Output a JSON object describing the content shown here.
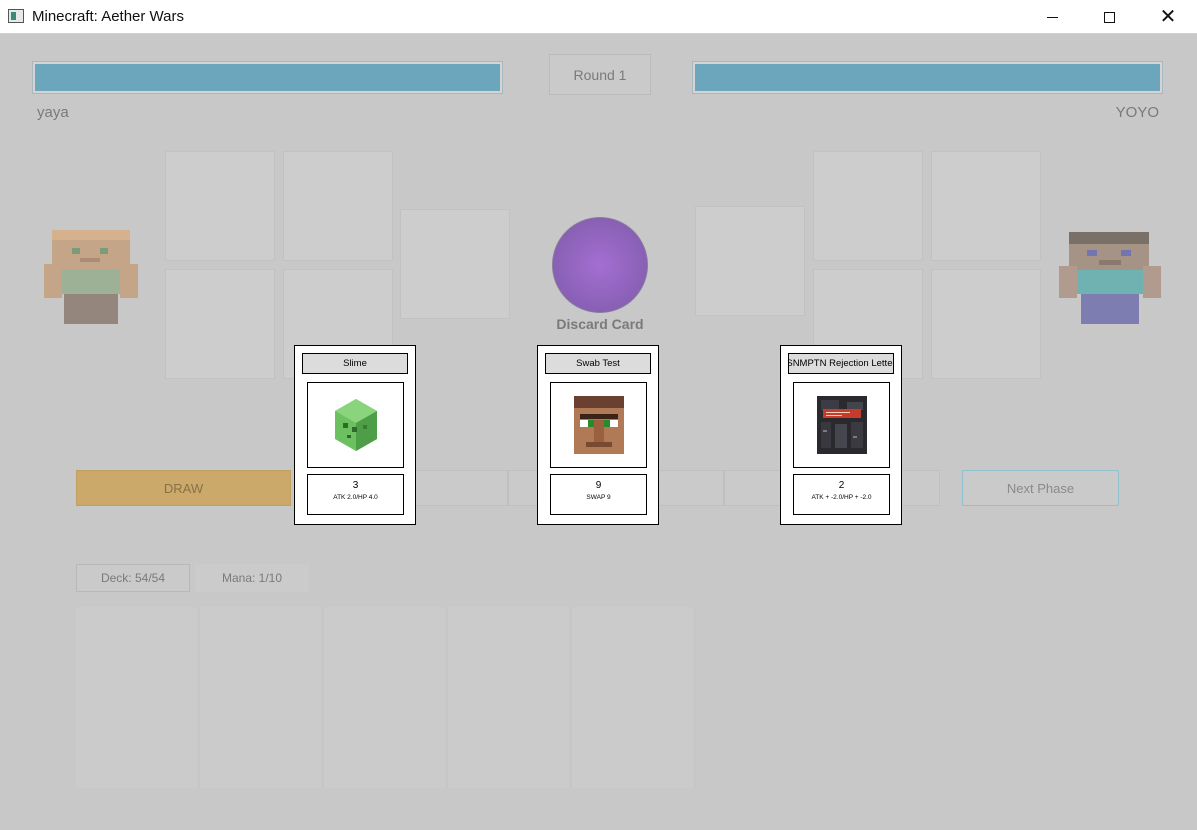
{
  "window": {
    "title": "Minecraft: Aether Wars"
  },
  "round": {
    "label": "Round 1"
  },
  "players": {
    "left": {
      "name": "yaya",
      "hp_fraction": 1.0
    },
    "right": {
      "name": "YOYO",
      "hp_fraction": 1.0
    }
  },
  "discard": {
    "label": "Discard Card"
  },
  "actions": {
    "draw_label": "DRAW",
    "next_phase_label": "Next Phase"
  },
  "status": {
    "deck": "Deck: 54/54",
    "mana": "Mana: 1/10"
  },
  "cards": [
    {
      "title": "Slime",
      "cost": "3",
      "effect": "ATK 2.0/HP 4.0",
      "art_icon": "slime-icon"
    },
    {
      "title": "Swab Test",
      "cost": "9",
      "effect": "SWAP 9",
      "art_icon": "villager-face-icon"
    },
    {
      "title": "SNMPTN Rejection Letter",
      "cost": "2",
      "effect": "ATK + -2.0/HP + -2.0",
      "art_icon": "rejection-letter-icon"
    }
  ],
  "colors": {
    "hp_bar": "#6ba6bd",
    "draw_button": "#cba96a",
    "orb": "#9a6cc8",
    "next_phase_border": "#8ec0d0"
  }
}
